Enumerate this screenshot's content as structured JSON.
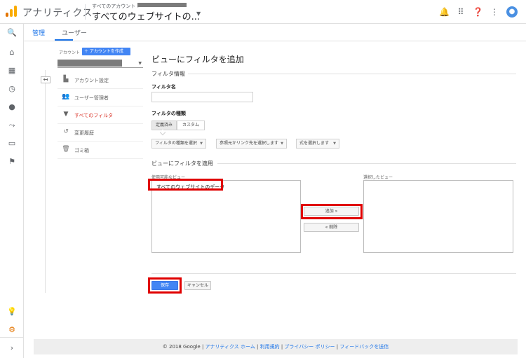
{
  "topbar": {
    "app_title": "アナリティクス",
    "account_path": "すべてのアカウント >",
    "current_view": "すべてのウェブサイトの..."
  },
  "tabs": [
    {
      "label": "管理",
      "active": true
    },
    {
      "label": "ユーザー",
      "active": false
    }
  ],
  "admin_column": {
    "account_label": "アカウント",
    "create_account_button": "アカウントを作成",
    "menu": [
      {
        "label": "アカウント設定",
        "icon": "account-settings-icon",
        "active": false
      },
      {
        "label": "ユーザー管理者",
        "icon": "users-icon",
        "active": false
      },
      {
        "label": "すべてのフィルタ",
        "icon": "filter-icon",
        "active": true
      },
      {
        "label": "変更履歴",
        "icon": "history-icon",
        "active": false
      },
      {
        "label": "ゴミ箱",
        "icon": "trash-icon",
        "active": false
      }
    ]
  },
  "form": {
    "title": "ビューにフィルタを追加",
    "filter_info_heading": "フィルタ情報",
    "filter_name_label": "フィルタ名",
    "filter_name_value": "",
    "filter_type_label": "フィルタの種類",
    "type_tabs": [
      {
        "label": "定義済み",
        "active": true
      },
      {
        "label": "カスタム",
        "active": false
      }
    ],
    "dropdowns": [
      "フィルタの種類を選択",
      "参照元かリンク先を選択します",
      "式を選択します"
    ],
    "apply_heading": "ビューにフィルタを適用",
    "available_views_label": "使用可能なビュー",
    "selected_views_label": "選択したビュー",
    "available_views": [
      "すべてのウェブサイトのデータ"
    ],
    "selected_views": [],
    "add_button": "追加 »",
    "remove_button": "« 削除",
    "save_button": "保存",
    "cancel_button": "キャンセル"
  },
  "footer": {
    "copyright": "© 2018 Google",
    "links": [
      "アナリティクス ホーム",
      "利用規約",
      "プライバシー ポリシー",
      "フィードバックを送信"
    ]
  },
  "colors": {
    "accent": "#1a73e8",
    "primary_button": "#4285f4",
    "active_menu": "#d93025",
    "highlight_box": "#e00000",
    "logo_orange": "#f9ab00",
    "logo_dark": "#e37400"
  }
}
